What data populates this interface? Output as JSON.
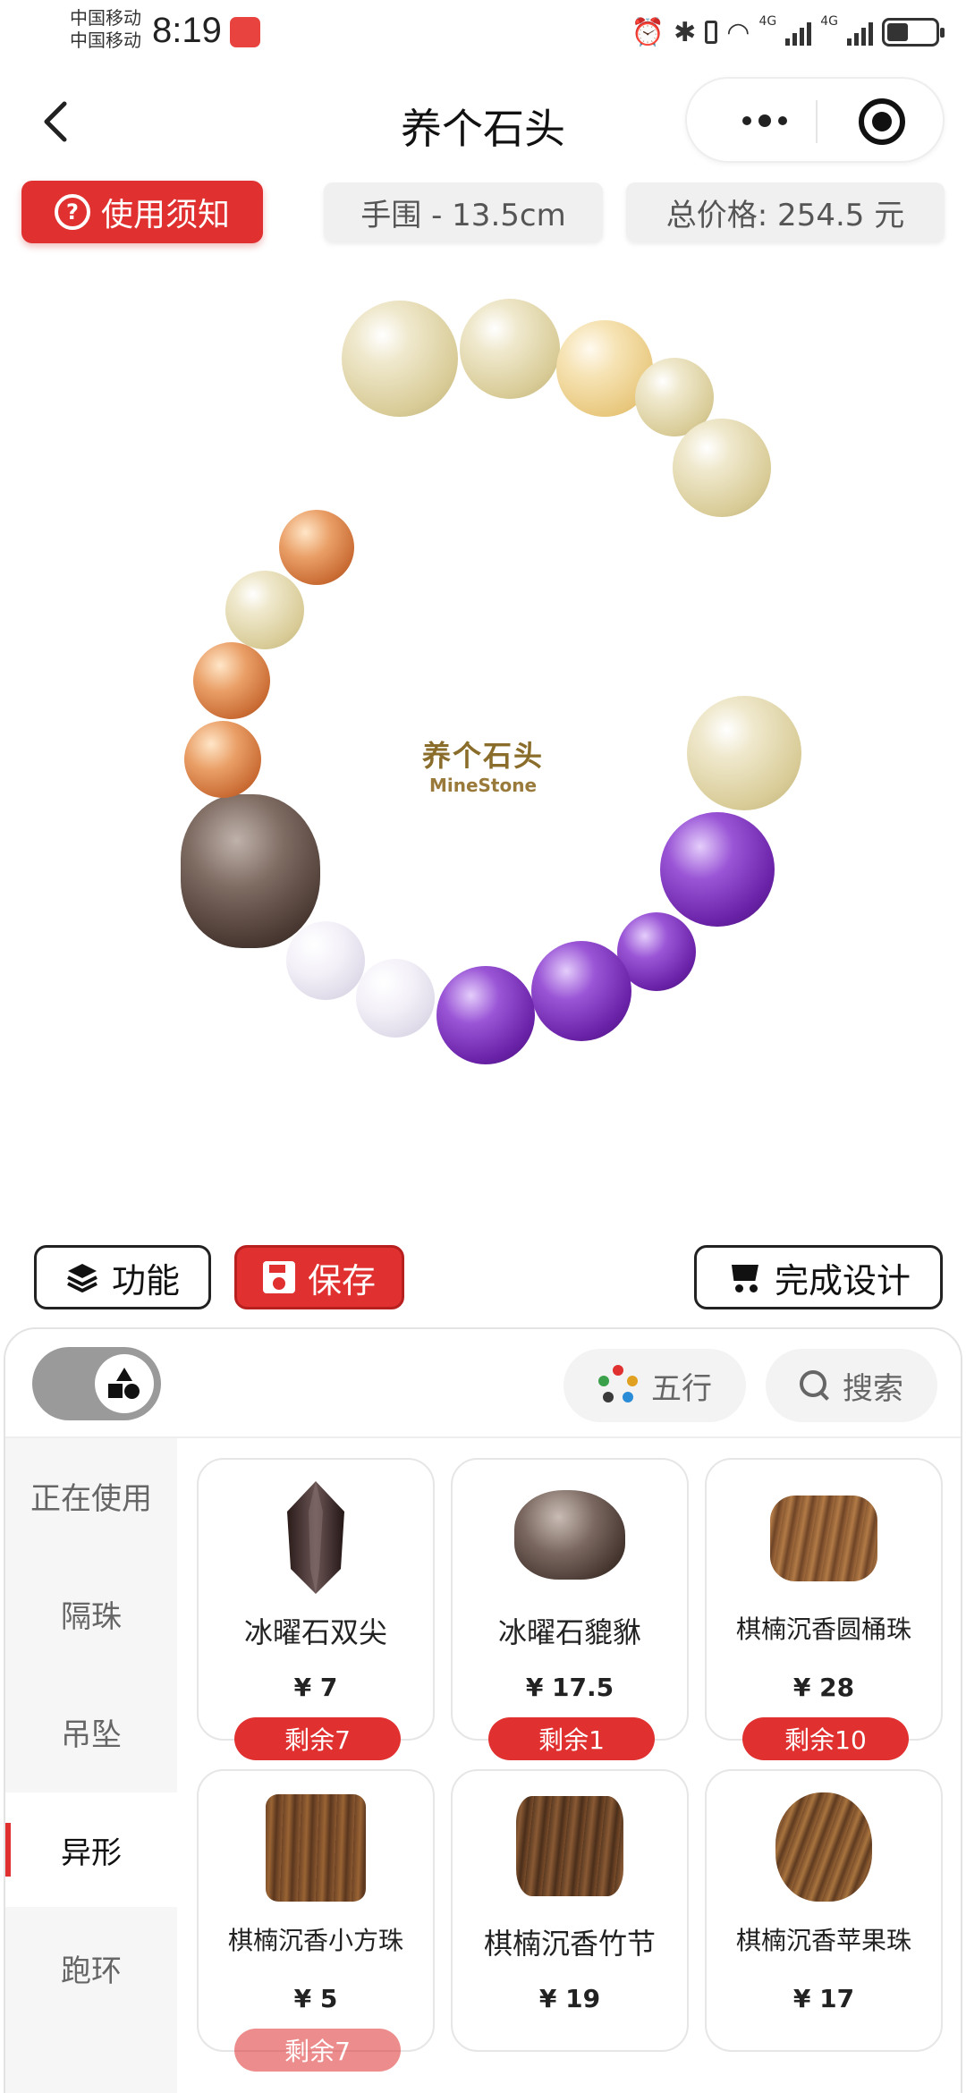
{
  "status_bar": {
    "carrier_1": "中国移动",
    "carrier_2": "中国移动",
    "time": "8:19",
    "network_1": "4G",
    "network_2": "4G",
    "battery_level": 0.45
  },
  "nav": {
    "title": "养个石头"
  },
  "info": {
    "notice_label": "使用须知",
    "wrist_size": "手围 - 13.5cm",
    "total_price": "总价格: 254.5 元"
  },
  "watermark": {
    "cn": "养个石头",
    "en": "MineStone"
  },
  "actions": {
    "function_label": "功能",
    "save_label": "保存",
    "finish_label": "完成设计"
  },
  "toolbar": {
    "wuxing_label": "五行",
    "search_label": "搜索"
  },
  "categories": [
    {
      "label": "正在使用",
      "active": false
    },
    {
      "label": "隔珠",
      "active": false
    },
    {
      "label": "吊坠",
      "active": false
    },
    {
      "label": "异形",
      "active": true
    },
    {
      "label": "跑环",
      "active": false
    }
  ],
  "products": [
    {
      "name": "冰曜石双尖",
      "price": "¥ 7",
      "stock": "剩余7"
    },
    {
      "name": "冰曜石貔貅",
      "price": "¥ 17.5",
      "stock": "剩余1"
    },
    {
      "name": "棋楠沉香圆桶珠",
      "price": "¥ 28",
      "stock": "剩余10"
    },
    {
      "name": "棋楠沉香小方珠",
      "price": "¥ 5",
      "stock": "剩余7"
    },
    {
      "name": "棋楠沉香竹节",
      "price": "¥ 19",
      "stock": ""
    },
    {
      "name": "棋楠沉香苹果珠",
      "price": "¥ 17",
      "stock": ""
    }
  ],
  "colors": {
    "accent_red": "#e03030",
    "amethyst": "#6a22a8",
    "citrine": "#e8d7a0",
    "agarwood": "#6e4a2c"
  }
}
